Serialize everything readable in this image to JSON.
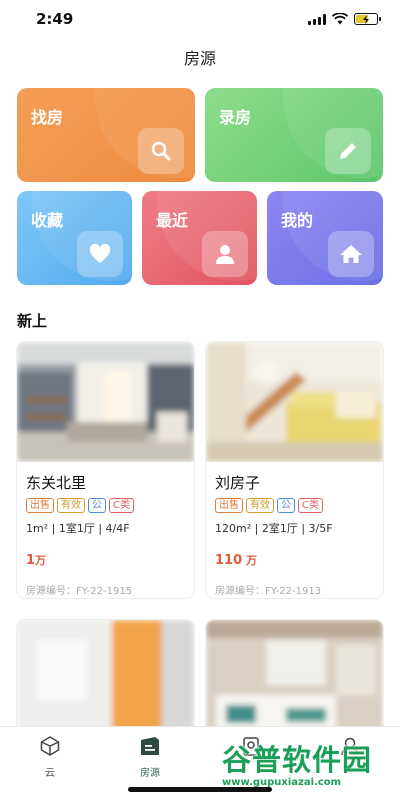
{
  "status": {
    "time": "2:49"
  },
  "nav": {
    "title": "房源"
  },
  "tiles": [
    {
      "label": "找房",
      "icon": "search-icon"
    },
    {
      "label": "录房",
      "icon": "pencil-icon"
    },
    {
      "label": "收藏",
      "icon": "heart-icon"
    },
    {
      "label": "最近",
      "icon": "person-icon"
    },
    {
      "label": "我的",
      "icon": "home-icon"
    }
  ],
  "section": {
    "title": "新上"
  },
  "listings": [
    {
      "title": "东关北里",
      "tags": [
        "出售",
        "有效",
        "公",
        "C类"
      ],
      "spec": "1m² | 1室1厅 | 4/4F",
      "price": "1",
      "price_unit": "万",
      "code": "房源编号：FY-22-1915"
    },
    {
      "title": "刘房子",
      "tags": [
        "出售",
        "有效",
        "公",
        "C类"
      ],
      "spec": "120m² | 2室1厅 | 3/5F",
      "price": "110",
      "price_unit": " 万",
      "code": "房源编号：FY-22-1913"
    }
  ],
  "tabbar": {
    "items": [
      {
        "label": "云",
        "icon": "cloud-cube-icon"
      },
      {
        "label": "房源",
        "icon": "listing-icon"
      },
      {
        "label": "",
        "icon": "contact-icon"
      },
      {
        "label": "",
        "icon": "profile-icon"
      }
    ]
  },
  "watermark": {
    "text": "谷普软件园",
    "url": "www.gupuxiazai.com"
  },
  "colors": {
    "accent": "#2f6b54",
    "price": "#e05a3c"
  }
}
